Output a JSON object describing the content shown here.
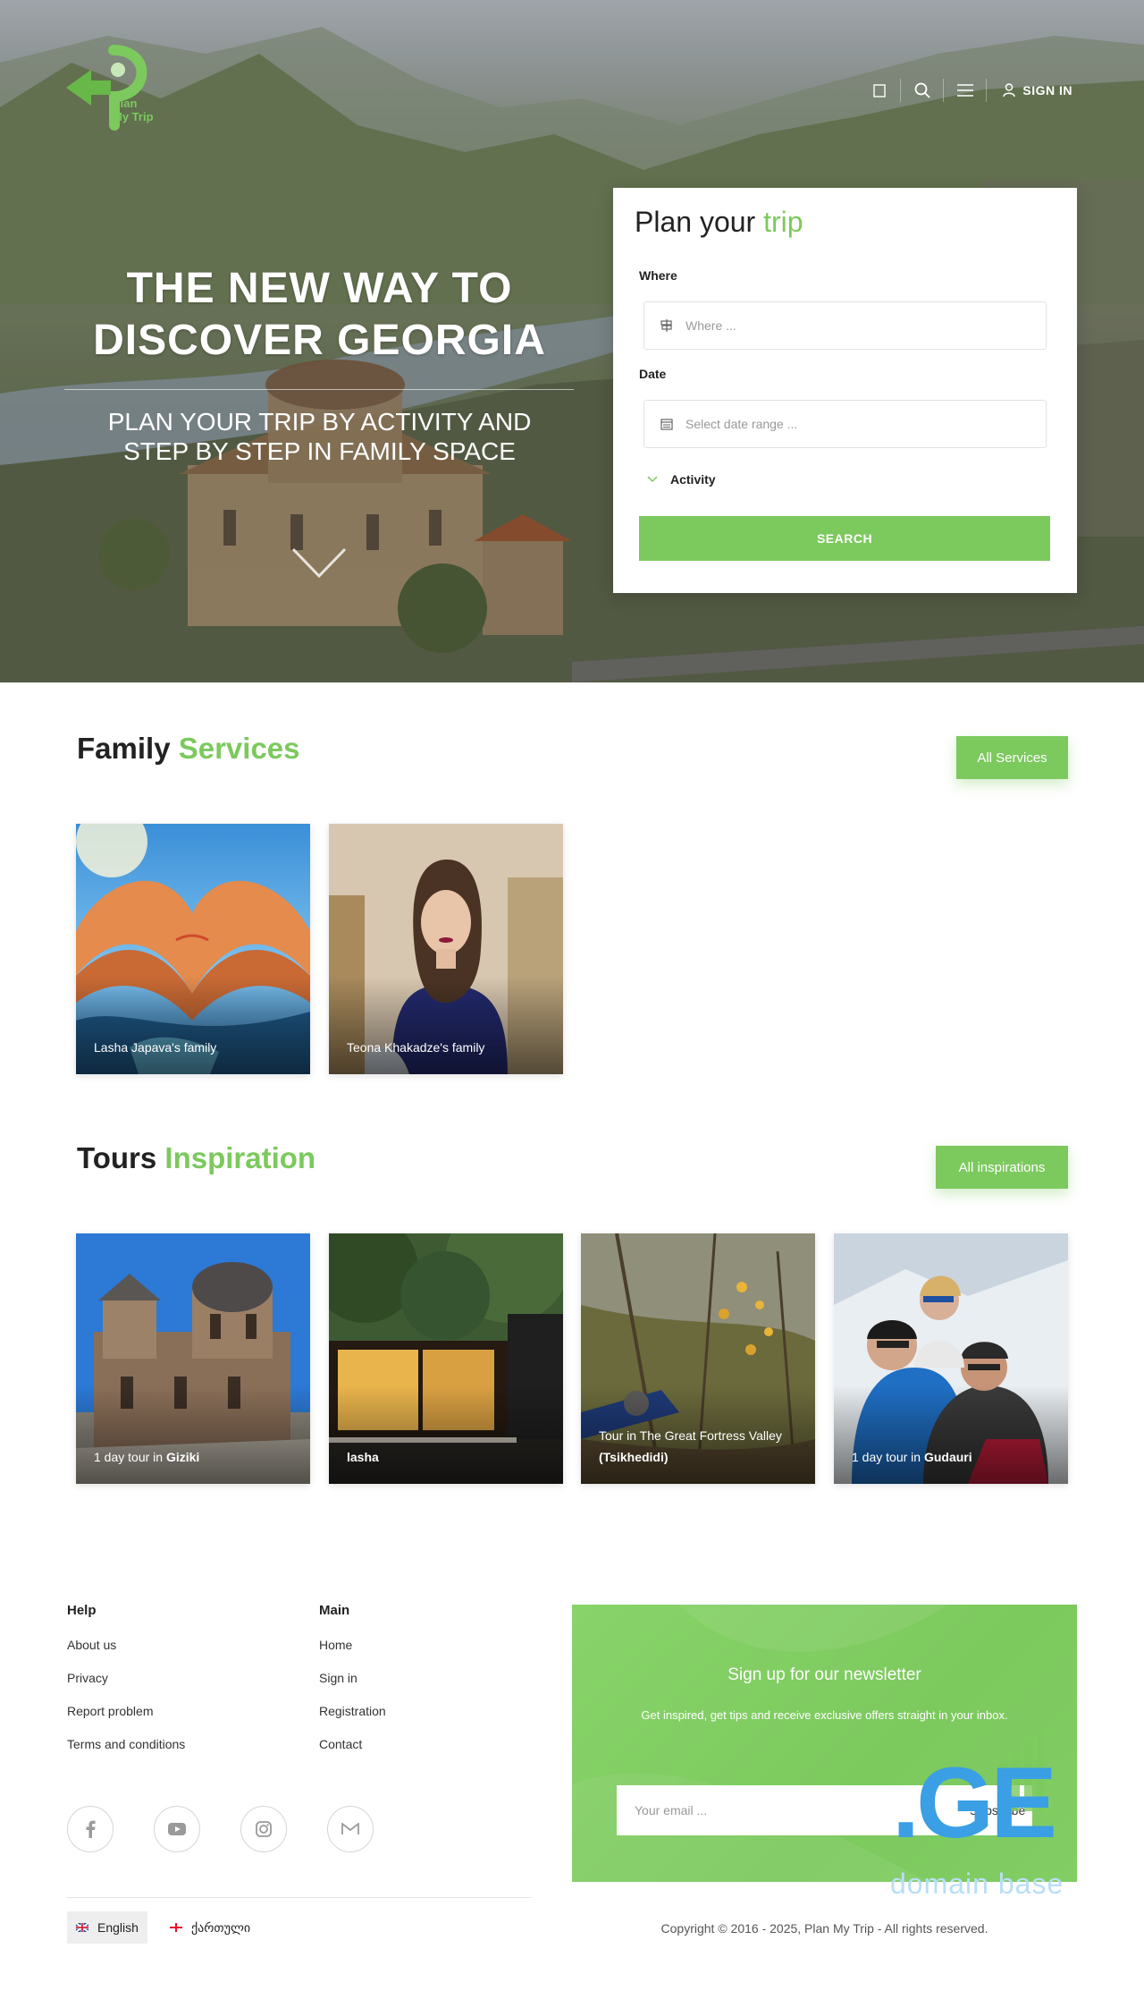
{
  "brand": {
    "logo_line1": "Plan",
    "logo_line2": "My Trip"
  },
  "nav": {
    "signin_label": "SIGN IN"
  },
  "hero": {
    "title_line1": "THE NEW WAY TO",
    "title_line2": "DISCOVER GEORGIA",
    "subtitle_line1": "PLAN YOUR TRIP BY ACTIVITY AND",
    "subtitle_line2": "STEP BY STEP IN FAMILY SPACE"
  },
  "plan": {
    "title_prefix": "Plan your",
    "title_accent": "trip",
    "where_label": "Where",
    "where_placeholder": "Where ...",
    "date_label": "Date",
    "date_placeholder": "Select date range ...",
    "activity_label": "Activity",
    "search_label": "SEARCH"
  },
  "family": {
    "title_prefix": "Family",
    "title_accent": "Services",
    "button_label": "All Services",
    "cards": [
      {
        "caption": "Lasha Japava's family"
      },
      {
        "caption": "Teona Khakadze's family"
      }
    ]
  },
  "tours": {
    "title_prefix": "Tours",
    "title_accent": "Inspiration",
    "button_label": "All inspirations",
    "cards": [
      {
        "caption_prefix": "1 day tour in",
        "caption_place": "Giziki"
      },
      {
        "caption_prefix": "",
        "caption_place": "lasha"
      },
      {
        "caption_prefix": "Tour in The Great Fortress Valley",
        "caption_place": "(Tsikhedidi)"
      },
      {
        "caption_prefix": "1 day tour in",
        "caption_place": "Gudauri"
      }
    ]
  },
  "footer": {
    "help": {
      "heading": "Help",
      "links": [
        "About us",
        "Privacy",
        "Report problem",
        "Terms and conditions"
      ]
    },
    "main": {
      "heading": "Main",
      "links": [
        "Home",
        "Sign in",
        "Registration",
        "Contact"
      ]
    },
    "socials": [
      "facebook-icon",
      "youtube-icon",
      "instagram-icon",
      "gmail-icon"
    ],
    "languages": {
      "active": "English",
      "alt": "ქართული"
    },
    "newsletter": {
      "title": "Sign up for our newsletter",
      "text": "Get inspired, get tips and receive exclusive offers straight in your inbox.",
      "email_placeholder": "Your email ...",
      "subscribe_label": "Subscribe"
    },
    "watermark": {
      "mark": ".GE",
      "sub": "domain base"
    },
    "copyright": "Copyright © 2016 - 2025, Plan My Trip - All rights reserved."
  },
  "colors": {
    "accent": "#7cc95e",
    "watermark": "#3a9fe4"
  }
}
